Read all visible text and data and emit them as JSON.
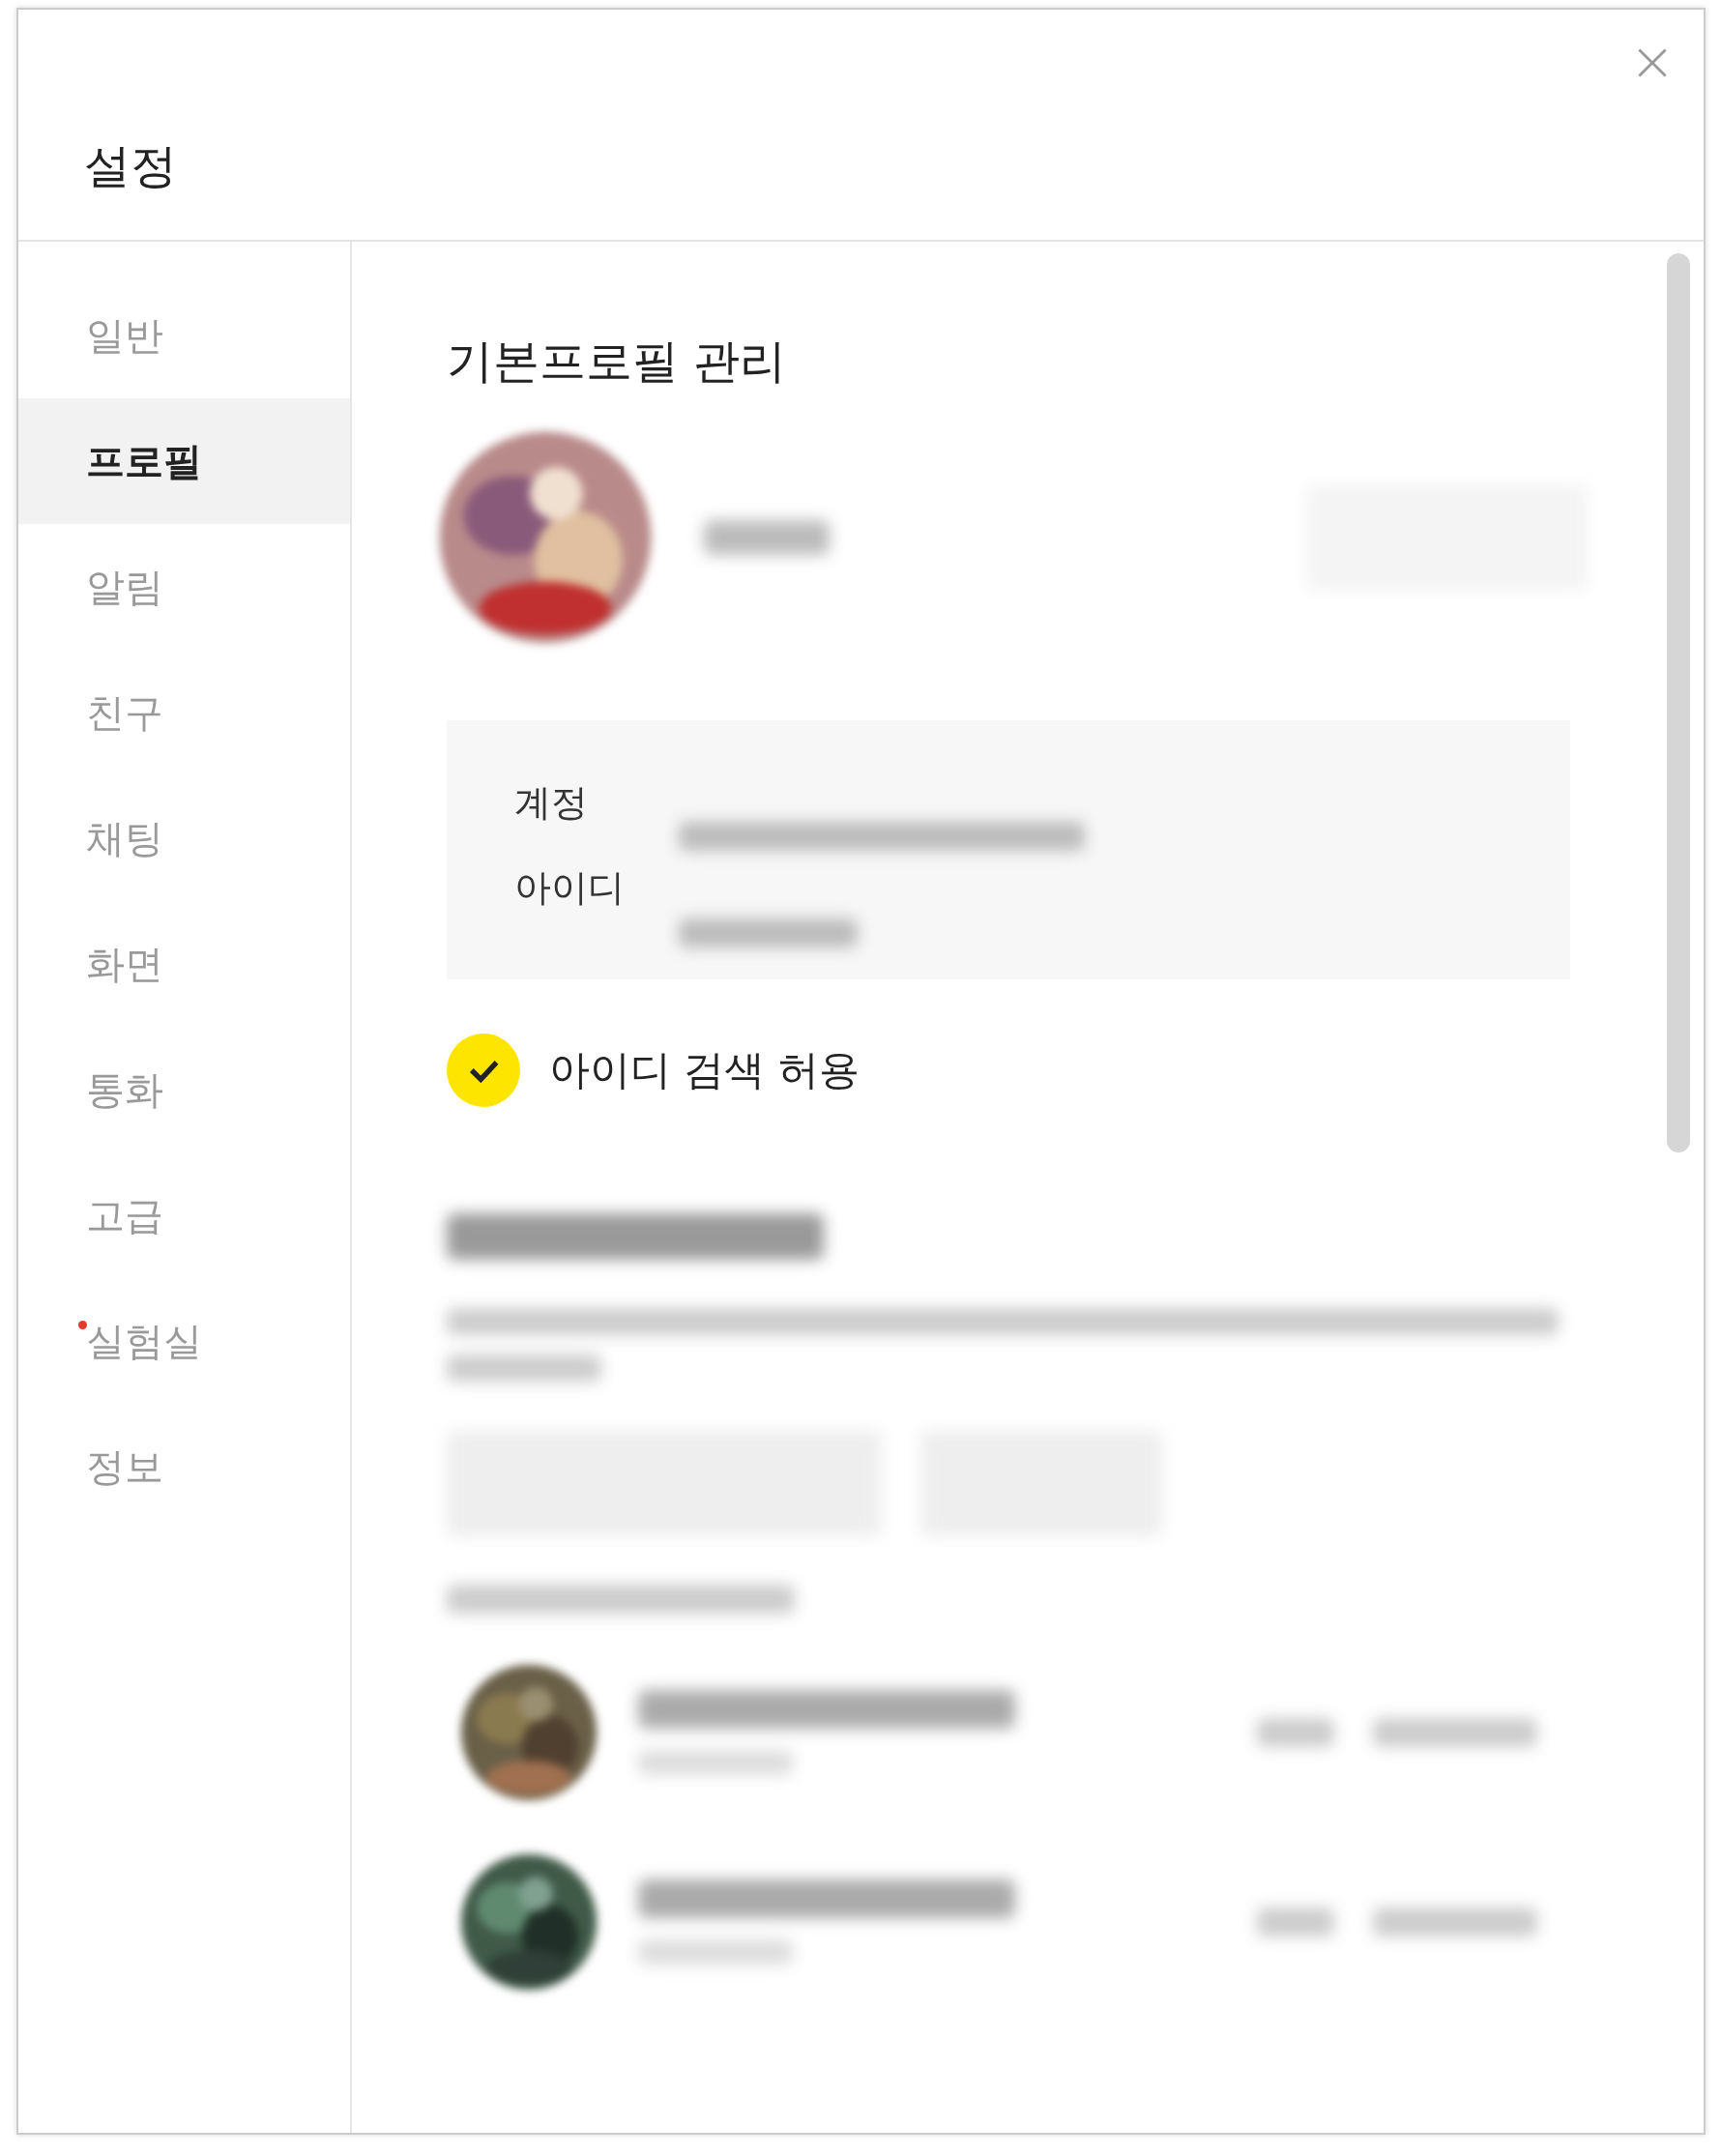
{
  "window": {
    "title": "설정"
  },
  "sidebar": {
    "items": [
      {
        "label": "일반",
        "selected": false,
        "dot": false
      },
      {
        "label": "프로필",
        "selected": true,
        "dot": false
      },
      {
        "label": "알림",
        "selected": false,
        "dot": false
      },
      {
        "label": "친구",
        "selected": false,
        "dot": false
      },
      {
        "label": "채팅",
        "selected": false,
        "dot": false
      },
      {
        "label": "화면",
        "selected": false,
        "dot": false
      },
      {
        "label": "통화",
        "selected": false,
        "dot": false
      },
      {
        "label": "고급",
        "selected": false,
        "dot": false
      },
      {
        "label": "실험실",
        "selected": false,
        "dot": true
      },
      {
        "label": "정보",
        "selected": false,
        "dot": false
      }
    ]
  },
  "content": {
    "heading": "기본프로필 관리",
    "account": {
      "labels": [
        "계정",
        "아이디"
      ]
    },
    "id_search": {
      "label": "아이디 검색 허용",
      "checked": true
    }
  }
}
